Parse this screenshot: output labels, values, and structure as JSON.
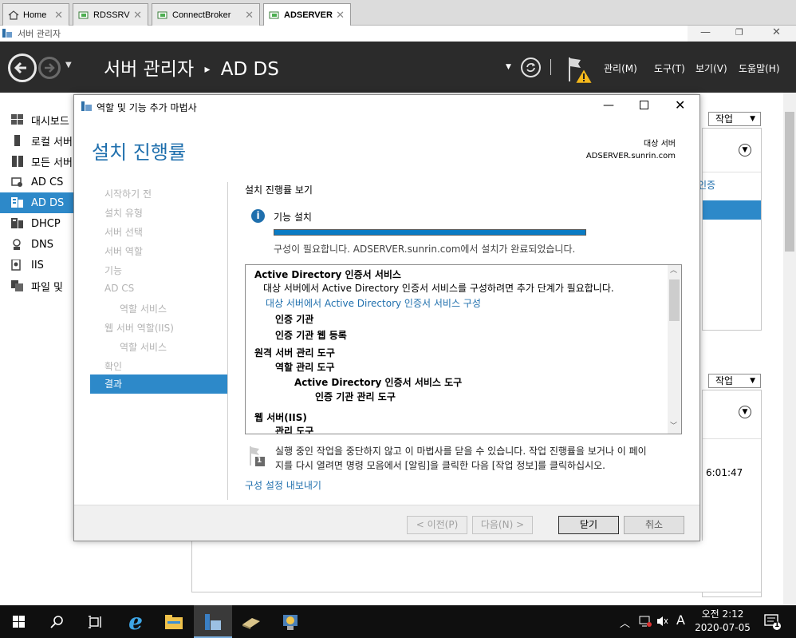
{
  "tabs": [
    {
      "label": "Home"
    },
    {
      "label": "RDSSRV"
    },
    {
      "label": "ConnectBroker"
    },
    {
      "label": "ADSERVER"
    }
  ],
  "server_manager": {
    "window_title": "서버 관리자",
    "breadcrumb_root": "서버 관리자",
    "breadcrumb_sep": "▸",
    "breadcrumb_page": "AD DS",
    "menu": [
      "관리(M)",
      "도구(T)",
      "보기(V)",
      "도움말(H)"
    ],
    "nav": [
      "대시보드",
      "로컬 서버",
      "모든 서버",
      "AD CS",
      "AD DS",
      "DHCP",
      "DNS",
      "IIS",
      "파일 및"
    ],
    "tasks_label": "작업",
    "bg_text_auth": "인증",
    "bg_text_time": "6:01:47"
  },
  "dialog": {
    "title": "역할 및 기능 추가 마법사",
    "heading": "설치 진행률",
    "dest_label": "대상 서버",
    "dest_server": "ADSERVER.sunrin.com",
    "steps": [
      "시작하기 전",
      "설치 유형",
      "서버 선택",
      "서버 역할",
      "기능",
      "AD CS",
      "역할 서비스",
      "웹 서버 역할(IIS)",
      "역할 서비스",
      "확인",
      "결과"
    ],
    "section_label": "설치 진행률 보기",
    "status_label": "기능 설치",
    "progress": 1.0,
    "progress_message": "구성이 필요합니다. ADSERVER.sunrin.com에서 설치가 완료되었습니다.",
    "details": {
      "adcs_title": "Active Directory 인증서 서비스",
      "adcs_note": "대상 서버에서 Active Directory 인증서 서비스를 구성하려면 추가 단계가 필요합니다.",
      "adcs_link": "대상 서버에서 Active Directory 인증서 서비스 구성",
      "ca": "인증 기관",
      "ca_web": "인증 기관 웹 등록",
      "rsat": "원격 서버 관리 도구",
      "role_tools": "역할 관리 도구",
      "adcs_tools": "Active Directory 인증서 서비스 도구",
      "ca_tools": "인증 기관 관리 도구",
      "web_server": "웹 서버(IIS)",
      "mgmt_tools": "관리 도구"
    },
    "notice": "실행 중인 작업을 중단하지 않고 이 마법사를 닫을 수 있습니다. 작업 진행률을 보거나 이 페이지를 다시 열려면 명령 모음에서 [알림]을 클릭한 다음 [작업 정보]를 클릭하십시오.",
    "notice_line1": "실행 중인 작업을 중단하지 않고 이 마법사를 닫을 수 있습니다. 작업 진행률을 보거나 이 페이",
    "notice_line2": "지를 다시 열려면 명령 모음에서 [알림]을 클릭한 다음 [작업 정보]를 클릭하십시오.",
    "notice_badge": "1",
    "export_link": "구성 설정 내보내기",
    "buttons": {
      "prev": "< 이전(P)",
      "next": "다음(N) >",
      "close": "닫기",
      "cancel": "취소"
    }
  },
  "taskbar": {
    "time": "오전 2:12",
    "date": "2020-07-05",
    "ime": "A",
    "notif_count": "1"
  },
  "colors": {
    "accent": "#2d89c9",
    "heading": "#1f6fad",
    "progress": "#0a7bc4",
    "smbar": "#2b2b2b"
  }
}
